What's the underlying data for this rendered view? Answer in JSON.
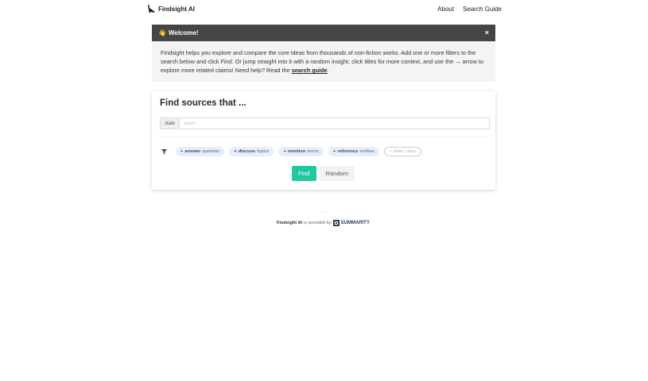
{
  "header": {
    "brand": "Findsight AI",
    "nav": [
      "About",
      "Search Guide"
    ]
  },
  "welcome": {
    "wave": "👋",
    "title": "Welcome!",
    "close": "×",
    "text_1": "Findsight helps you explore and compare the core ideas from thousands of non-fiction works. Add one or more filters to the search below and click ",
    "text_find": "Find",
    "text_2": ". Or jump straight into it with a random insight, click titles for more context, and use the → arrow to explore more related claims! Need help? Read the ",
    "link": "search guide",
    "text_3": "."
  },
  "search": {
    "title": "Find sources that ...",
    "filter_tag": "state",
    "filter_placeholder": "claim",
    "chips": [
      {
        "plus": "+",
        "verb": "answer",
        "noun": "question"
      },
      {
        "plus": "+",
        "verb": "discuss",
        "noun": "topics"
      },
      {
        "plus": "+",
        "verb": "mention",
        "noun": "terms"
      },
      {
        "plus": "+",
        "verb": "reference",
        "noun": "entities"
      },
      {
        "plus": "+",
        "verb": "state",
        "noun": "claim"
      }
    ],
    "find_label": "Find",
    "random_label": "Random"
  },
  "footer": {
    "dots": "...",
    "brand": "Findsight AI",
    "provided": "is provided by",
    "provider": "SUMMARITY"
  }
}
